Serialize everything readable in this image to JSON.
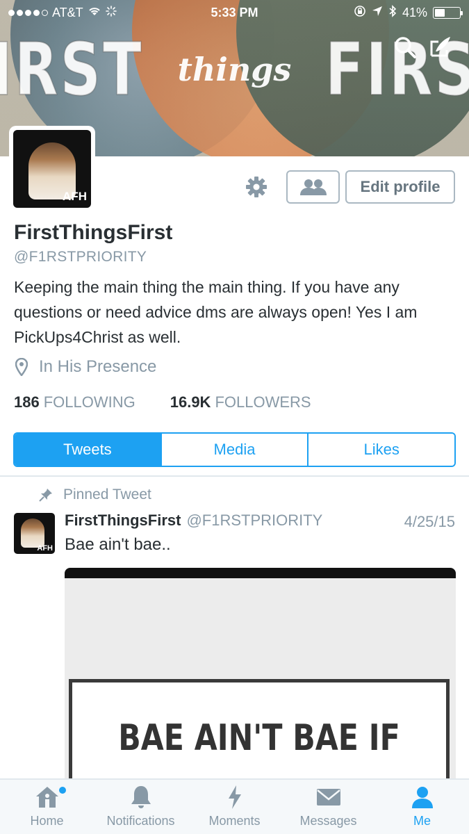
{
  "status_bar": {
    "carrier": "AT&T",
    "time": "5:33 PM",
    "battery": "41%",
    "battery_level": 0.41
  },
  "header": {
    "banner_word_left": "FIRST",
    "banner_word_mid": "things",
    "banner_word_right": "FIRST",
    "search_icon": "search-icon",
    "compose_icon": "compose-icon"
  },
  "profile": {
    "avatar_text": "AFH",
    "name": "FirstThingsFirst",
    "handle": "@F1RSTPRIORITY",
    "bio": "Keeping the main thing the main thing. If you have any questions or need advice dms are always open! Yes I am PickUps4Christ as well.",
    "location": "In His Presence",
    "following_count": "186",
    "following_label": "FOLLOWING",
    "followers_count": "16.9K",
    "followers_label": "FOLLOWERS"
  },
  "actions": {
    "settings_icon": "gear-icon",
    "people_icon": "people-icon",
    "edit_profile": "Edit profile"
  },
  "tabs": [
    {
      "label": "Tweets",
      "active": true
    },
    {
      "label": "Media",
      "active": false
    },
    {
      "label": "Likes",
      "active": false
    }
  ],
  "pinned_tweet": {
    "pinned_label": "Pinned Tweet",
    "author": "FirstThingsFirst",
    "handle": "@F1RSTPRIORITY",
    "date": "4/25/15",
    "text": "Bae ain't bae..",
    "avatar_text": "AFH",
    "image_text": "BAE AIN'T BAE IF"
  },
  "bottom_nav": [
    {
      "label": "Home",
      "icon": "home-icon",
      "active": false
    },
    {
      "label": "Notifications",
      "icon": "bell-icon",
      "active": false
    },
    {
      "label": "Moments",
      "icon": "lightning-icon",
      "active": false
    },
    {
      "label": "Messages",
      "icon": "envelope-icon",
      "active": false
    },
    {
      "label": "Me",
      "icon": "person-icon",
      "active": true
    }
  ],
  "colors": {
    "accent": "#1da1f2",
    "text": "#292f33",
    "muted": "#8899a6"
  }
}
